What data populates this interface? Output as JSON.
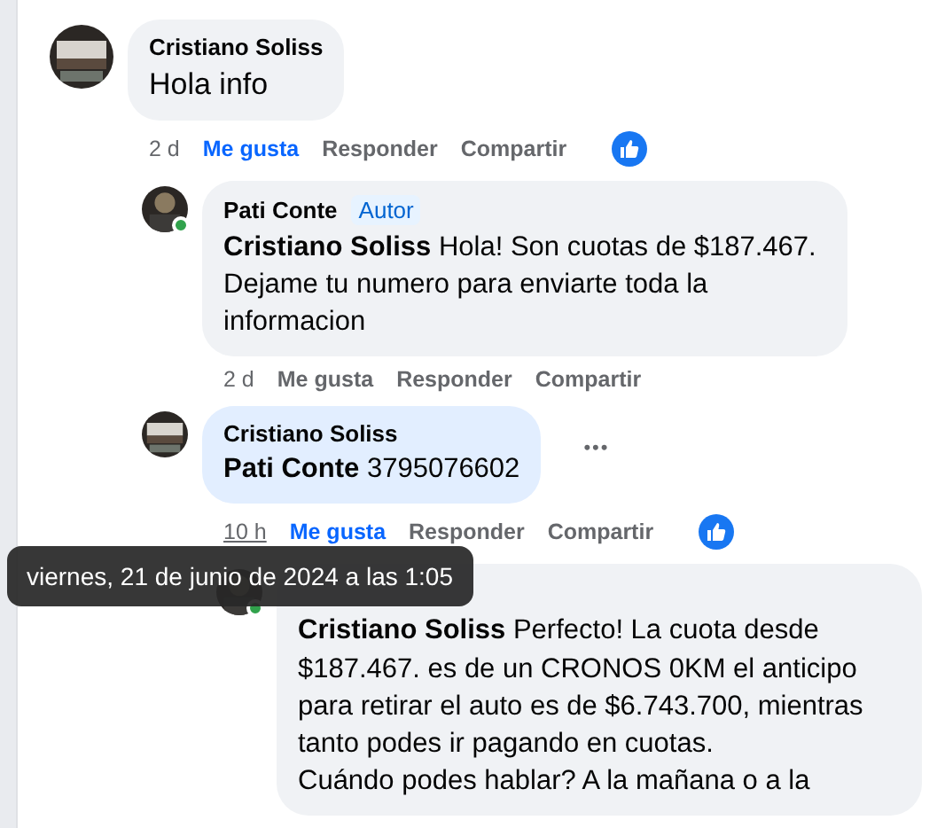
{
  "comments": [
    {
      "author": "Cristiano Soliss",
      "online": false,
      "text": "Hola info",
      "time": "2 d",
      "liked": true,
      "has_reaction": true,
      "highlighted": false,
      "actions": [
        "Me gusta",
        "Responder",
        "Compartir"
      ],
      "children": [
        {
          "author": "Pati Conte",
          "badge": "Autor",
          "online": true,
          "mention": "Cristiano Soliss",
          "text": "Hola! Son cuotas de $187.467. Dejame tu numero para enviarte toda la informacion",
          "time": "2 d",
          "liked": false,
          "has_reaction": false,
          "highlighted": false,
          "actions": [
            "Me gusta",
            "Responder",
            "Compartir"
          ]
        },
        {
          "author": "Cristiano Soliss",
          "online": false,
          "mention": "Pati Conte",
          "text": "3795076602",
          "more_label": "•••",
          "time": "10 h",
          "liked": true,
          "has_reaction": true,
          "highlighted": true,
          "tooltip": "viernes, 21 de junio de 2024 a las 1:05",
          "actions": [
            "Me gusta",
            "Responder",
            "Compartir"
          ],
          "children": [
            {
              "online": true,
              "mention": "Cristiano Soliss",
              "text": "Perfecto! La cuota desde $187.467. es de un CRONOS 0KM el anticipo para retirar el auto es de $6.743.700, mientras tanto podes ir pagando en cuotas.\nCuándo podes hablar? A la mañana o a la",
              "highlighted": false
            }
          ]
        }
      ]
    }
  ]
}
